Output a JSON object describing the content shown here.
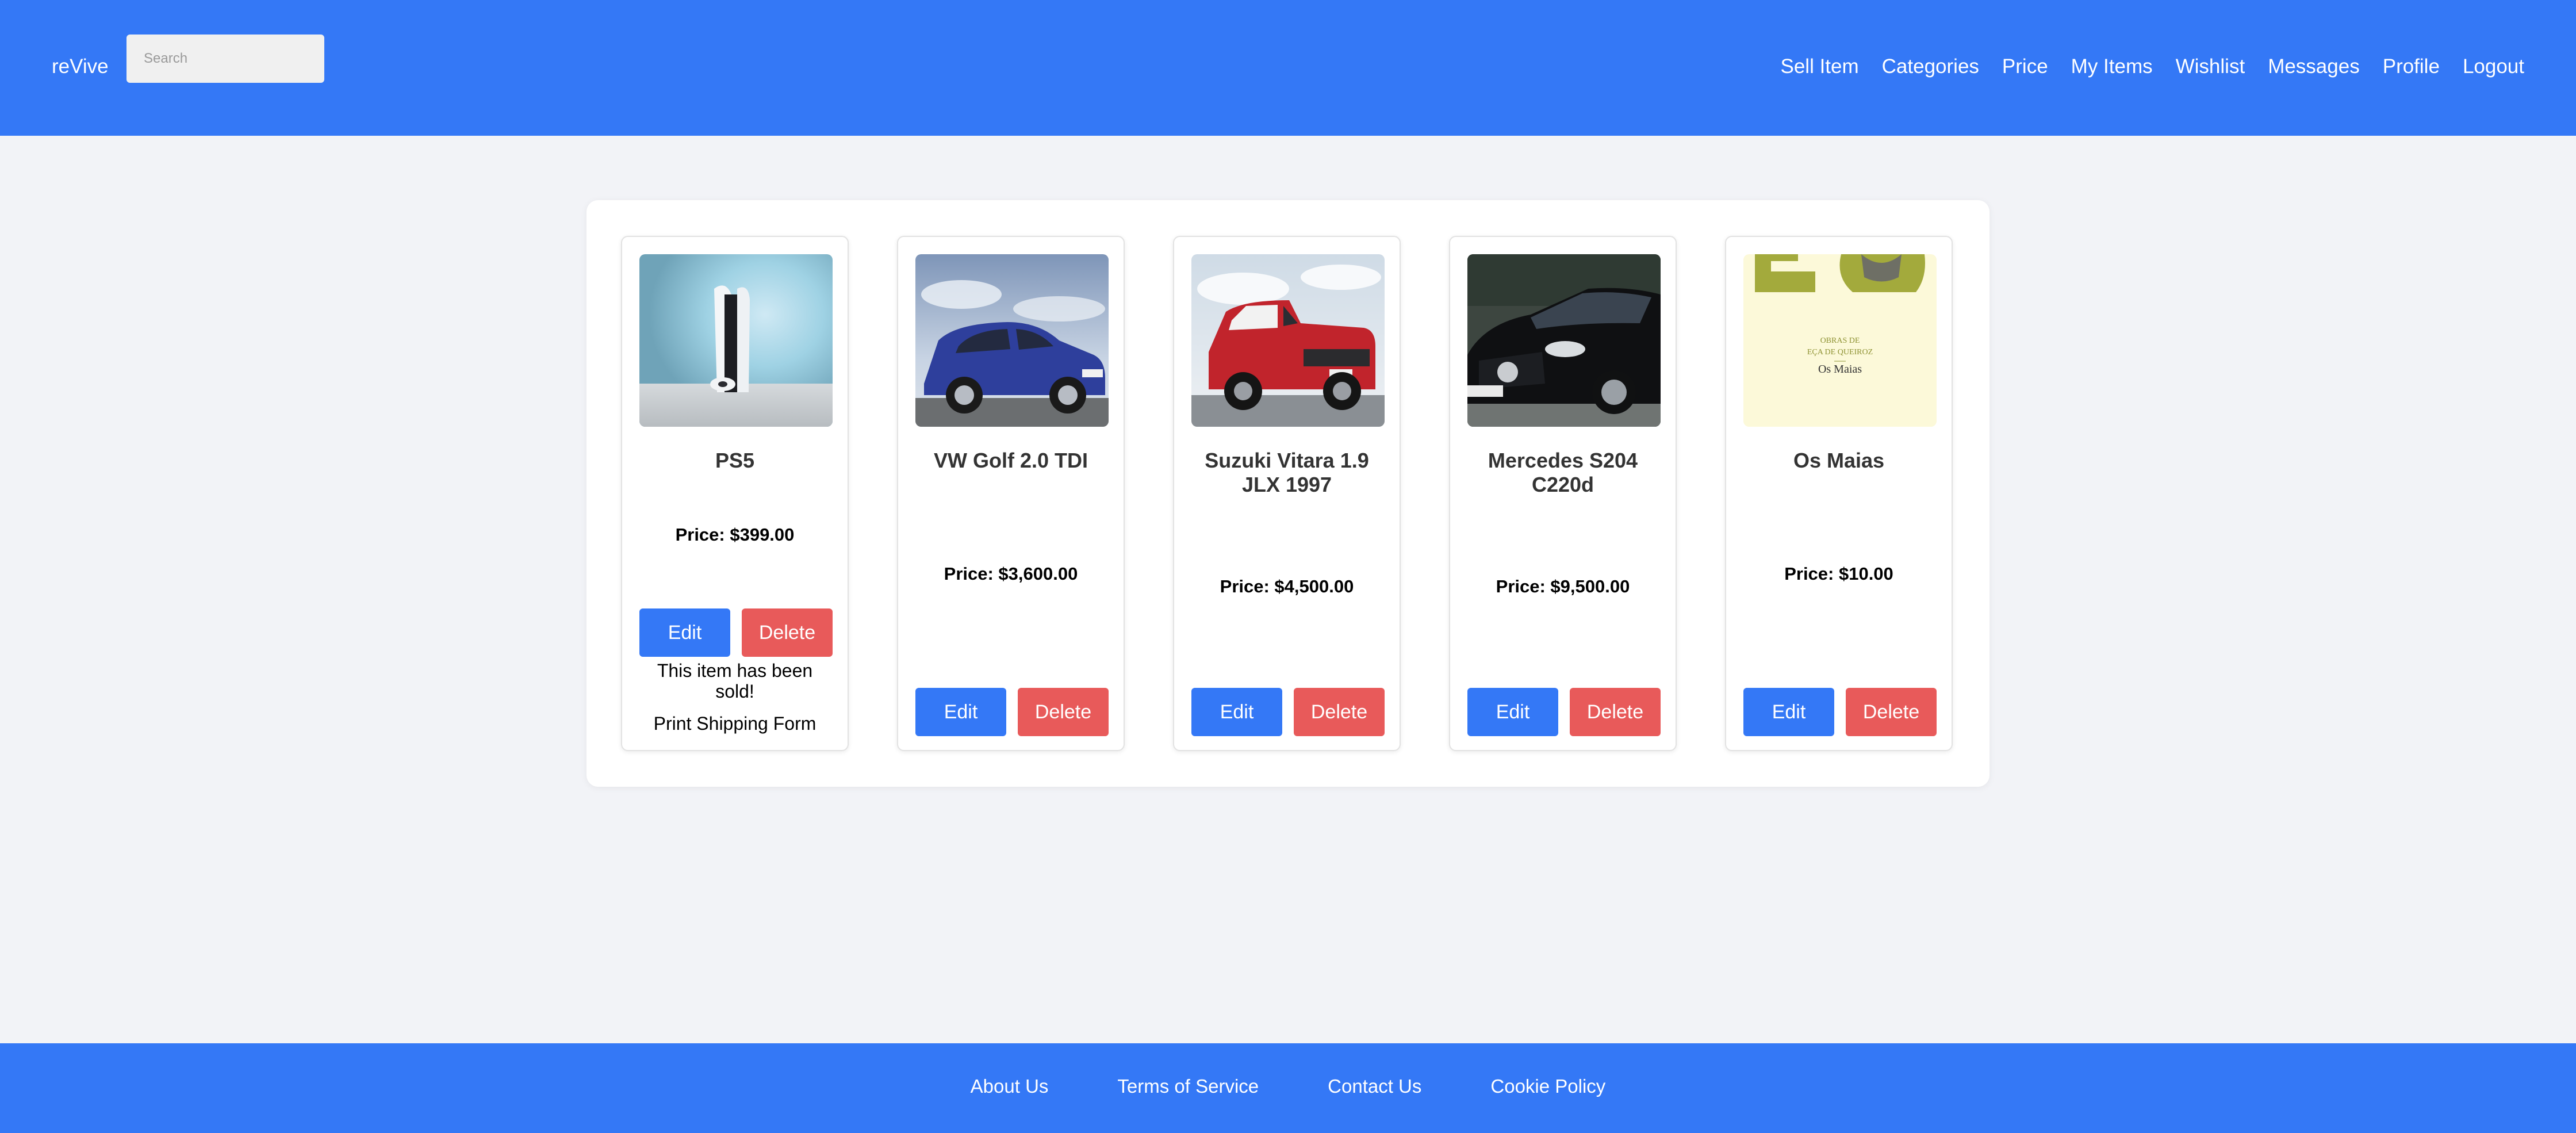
{
  "header": {
    "brand": "reVive",
    "search_placeholder": "Search",
    "nav": [
      "Sell Item",
      "Categories",
      "Price",
      "My Items",
      "Wishlist",
      "Messages",
      "Profile",
      "Logout"
    ]
  },
  "items": [
    {
      "title": "PS5",
      "price": "Price: $399.00",
      "edit": "Edit",
      "delete": "Delete",
      "sold_text": "This item has been sold!",
      "print_link": "Print Shipping Form",
      "image": "ps5-console-image"
    },
    {
      "title": "VW Golf 2.0 TDI",
      "price": "Price: $3,600.00",
      "edit": "Edit",
      "delete": "Delete",
      "image": "blue-hatchback-car-image"
    },
    {
      "title": "Suzuki Vitara 1.9 JLX 1997",
      "price": "Price: $4,500.00",
      "edit": "Edit",
      "delete": "Delete",
      "image": "red-suv-image"
    },
    {
      "title": "Mercedes S204 C220d",
      "price": "Price: $9,500.00",
      "edit": "Edit",
      "delete": "Delete",
      "image": "black-estate-car-image"
    },
    {
      "title": "Os Maias",
      "price": "Price: $10.00",
      "edit": "Edit",
      "delete": "Delete",
      "image": "book-cover-image",
      "cover_text": [
        "OBRAS DE",
        "EÇA DE QUEIROZ",
        "Os Maias"
      ]
    }
  ],
  "footer": {
    "links": [
      "About Us",
      "Terms of Service",
      "Contact Us",
      "Cookie Policy"
    ]
  },
  "colors": {
    "brand_blue": "#3478f6",
    "delete_red": "#e85a5a",
    "background": "#f2f3f7"
  }
}
